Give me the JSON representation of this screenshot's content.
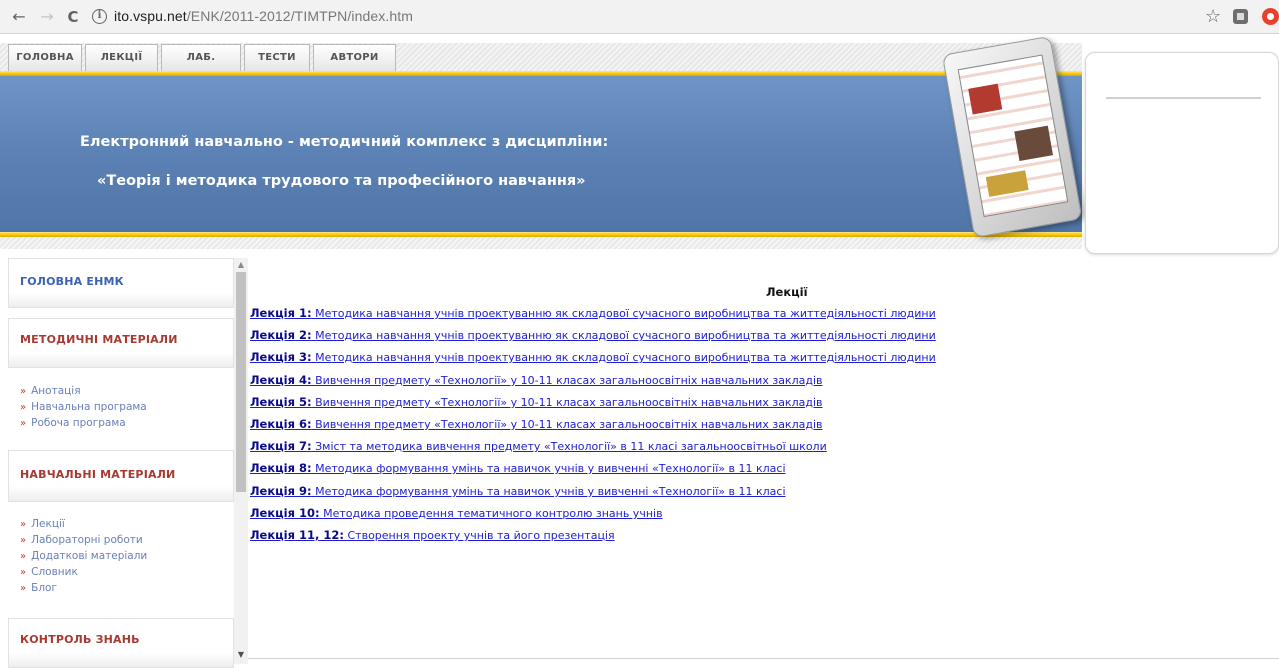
{
  "browser": {
    "back": "←",
    "forward": "→",
    "reload": "C",
    "info": "i",
    "url_host": "ito.vspu.net",
    "url_path": "/ENK/2011-2012/TIMTPN/index.htm",
    "star": "☆"
  },
  "nav_tabs": [
    {
      "label": "ГОЛОВНА"
    },
    {
      "label": "ЛЕКЦІЇ"
    },
    {
      "label": "ЛАБ. РОБОТИ"
    },
    {
      "label": "ТЕСТИ"
    },
    {
      "label": "АВТОРИ"
    }
  ],
  "banner": {
    "line1": "Електронний навчально - методичний комплекс з дисципліни:",
    "line2": "«Теорія і методика трудового та професійного навчання»"
  },
  "sidebar": {
    "main_heading": "ГОЛОВНА ЕНМК",
    "methodical_heading": "МЕТОДИЧНІ МАТЕРІАЛИ",
    "methodical_links": [
      "Анотація",
      "Навчальна програма",
      "Робоча програма"
    ],
    "educational_heading": "НАВЧАЛЬНІ МАТЕРІАЛИ",
    "educational_links": [
      "Лекції",
      "Лабораторні роботи",
      "Додаткові матеріали",
      "Словник",
      "Блог"
    ],
    "control_heading": "КОНТРОЛЬ ЗНАНЬ",
    "bullet": "»"
  },
  "main": {
    "heading": "Лекції",
    "lectures": [
      {
        "num": "Лекція 1:",
        "title": "Методика навчання учнів проектуванню як складової сучасного виробництва та життедіяльності людини"
      },
      {
        "num": "Лекція 2:",
        "title": "Методика навчання учнів проектуванню як складової сучасного виробництва та життедіяльності людини"
      },
      {
        "num": "Лекція 3:",
        "title": "Методика навчання учнів проектуванню як складової сучасного виробництва та життедіяльності людини"
      },
      {
        "num": "Лекція 4:",
        "title": "Вивчення предмету «Технології» у 10-11 класах загальноосвітніх навчальних закладів"
      },
      {
        "num": "Лекція 5:",
        "title": "Вивчення предмету «Технології» у 10-11 класах загальноосвітніх навчальних закладів"
      },
      {
        "num": "Лекція 6:",
        "title": "Вивчення предмету «Технології» у 10-11 класах загальноосвітніх навчальних закладів"
      },
      {
        "num": "Лекція 7:",
        "title": "Зміст та методика вивчення предмету «Технології» в 11 класі загальноосвітньої школи"
      },
      {
        "num": "Лекція 8:",
        "title": "Методика формування умінь та навичок учнів у вивченні «Технології» в 11 класі"
      },
      {
        "num": "Лекція 9:",
        "title": "Методика формування умінь та навичок учнів у вивченні «Технології» в 11 класі"
      },
      {
        "num": "Лекція 10:",
        "title": "Методика проведення тематичного контролю знань учнів"
      },
      {
        "num": "Лекція 11, 12:",
        "title": "Створення проекту учнів та його презентація"
      }
    ]
  },
  "colors": {
    "banner_blue": "#5d82b5",
    "gold": "#f5c400",
    "link_blue": "#1d1dd1",
    "heading_red": "#a63a32",
    "heading_blue": "#3a62b0"
  }
}
